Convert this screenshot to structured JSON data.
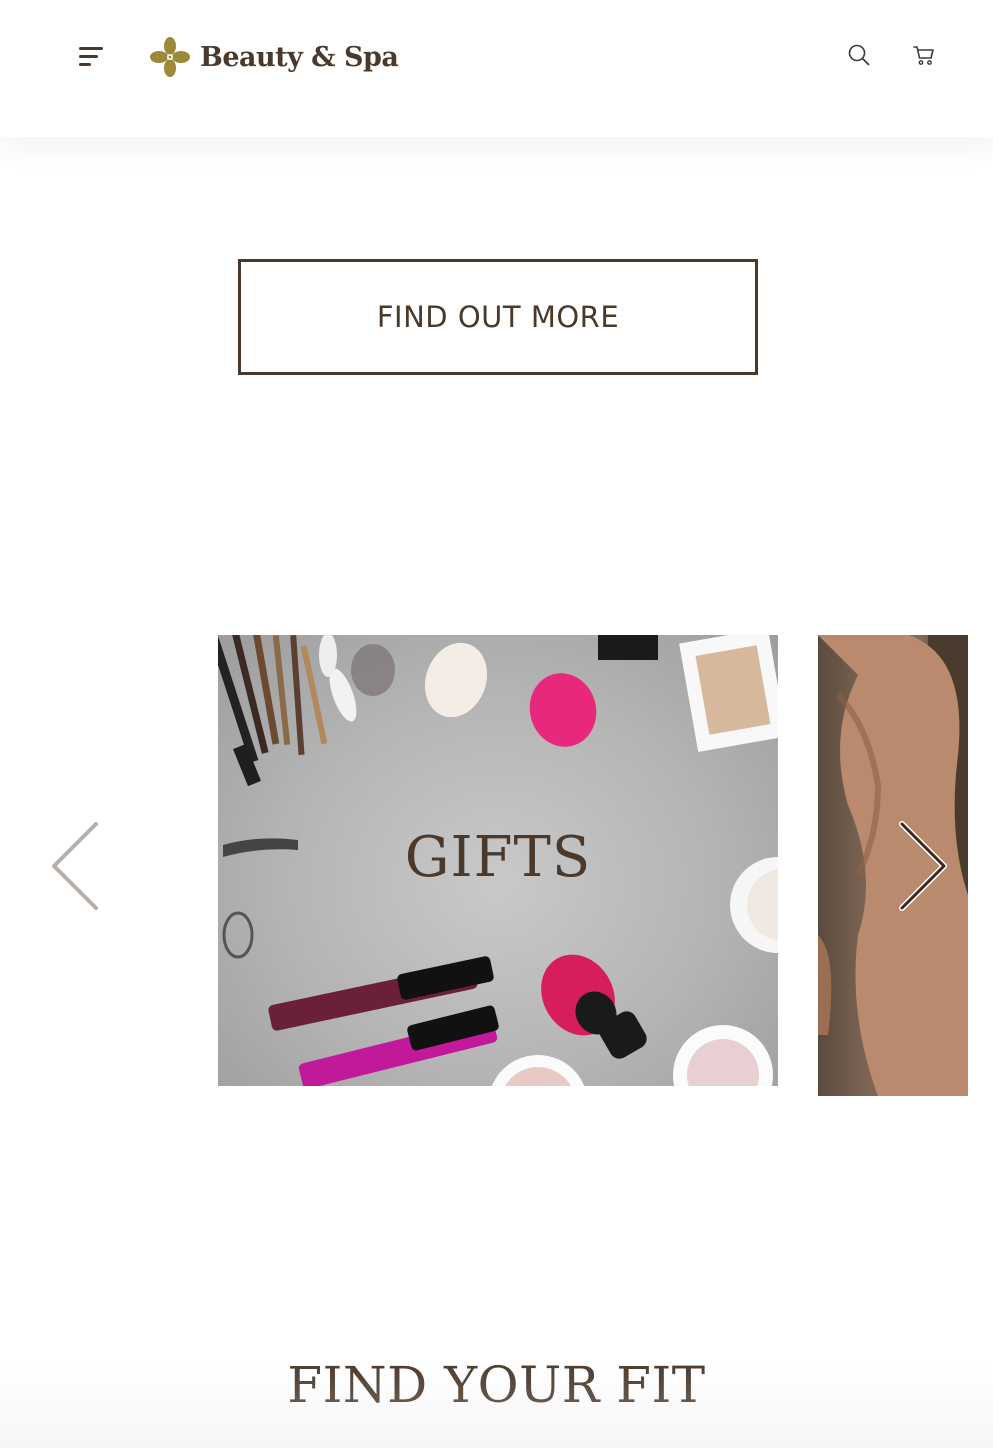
{
  "header": {
    "brand": "Beauty & Spa",
    "icons": {
      "menu": "menu-icon",
      "logo": "flower-logo-icon",
      "search": "search-icon",
      "cart": "cart-icon"
    }
  },
  "hero": {
    "cta_label": "FIND OUT MORE"
  },
  "carousel": {
    "slides": [
      {
        "title": "GIFTS"
      }
    ],
    "prev_icon": "chevron-left-icon",
    "next_icon": "chevron-right-icon"
  },
  "section": {
    "title": "FIND YOUR FIT"
  },
  "colors": {
    "brand_brown": "#4b3a2c",
    "logo_gold": "#9c8a3a"
  }
}
